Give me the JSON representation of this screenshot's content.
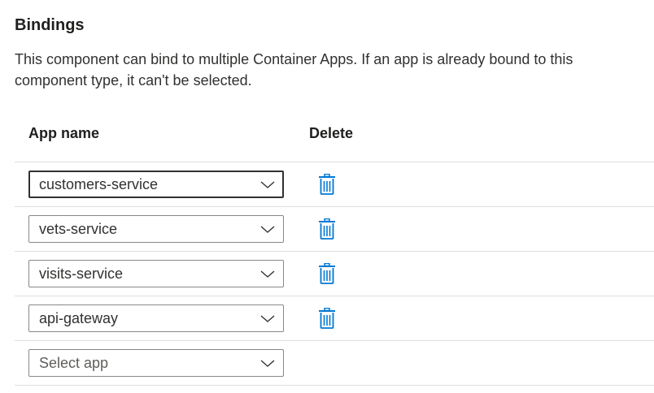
{
  "section": {
    "title": "Bindings",
    "description": "This component can bind to multiple Container Apps. If an app is already bound to this component type, it can't be selected."
  },
  "table": {
    "headers": {
      "app_name": "App name",
      "delete": "Delete"
    },
    "rows": [
      {
        "app": "customers-service",
        "focused": true,
        "has_delete": true
      },
      {
        "app": "vets-service",
        "focused": false,
        "has_delete": true
      },
      {
        "app": "visits-service",
        "focused": false,
        "has_delete": true
      },
      {
        "app": "api-gateway",
        "focused": false,
        "has_delete": true
      }
    ],
    "new_row": {
      "placeholder": "Select app"
    }
  },
  "icons": {
    "chevron": "chevron-down-icon",
    "delete": "trash-icon"
  },
  "colors": {
    "accent": "#0078d4",
    "border": "#8a8886",
    "focused_border": "#323130",
    "divider": "#e1dfdd",
    "text": "#201f1e",
    "placeholder": "#605e5c"
  }
}
